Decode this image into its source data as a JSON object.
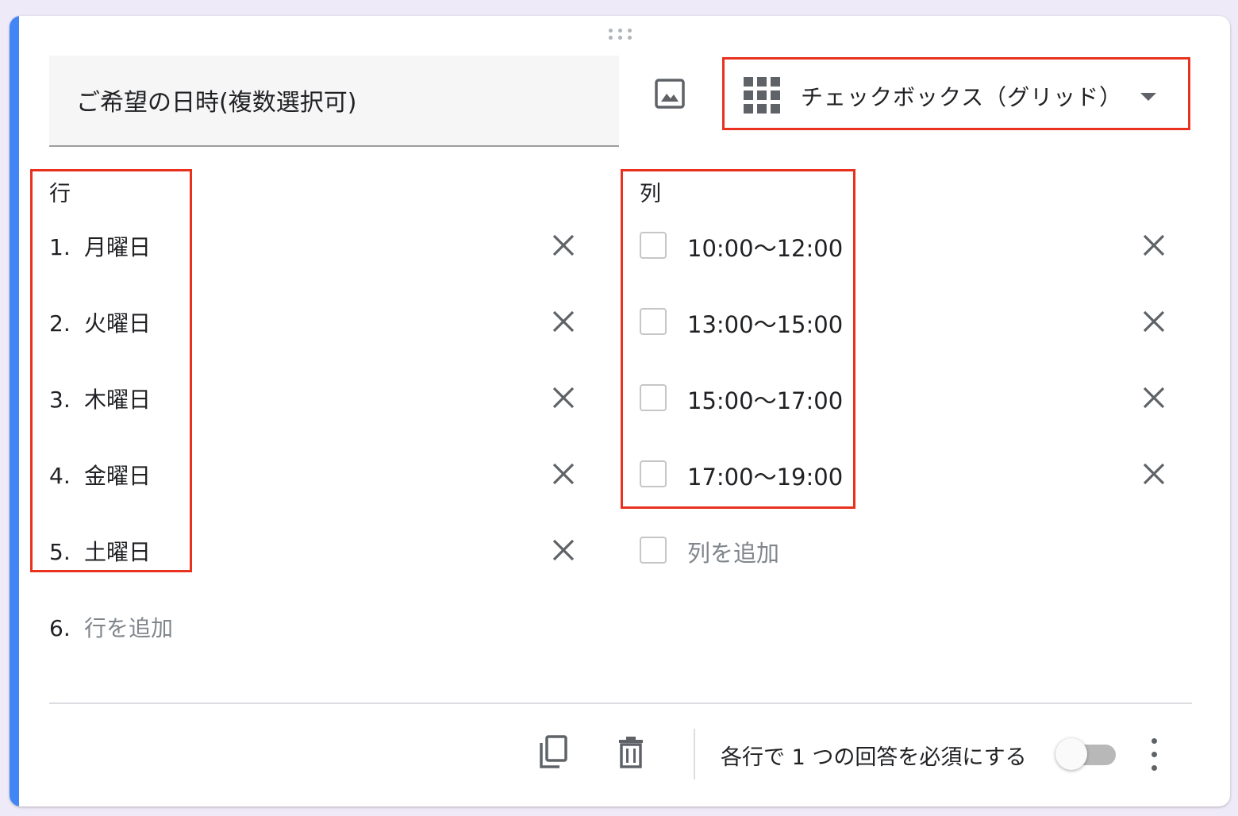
{
  "question": {
    "title": "ご希望の日時(複数選択可)"
  },
  "question_type": {
    "label": "チェックボックス（グリッド）",
    "icon": "grid-icon"
  },
  "rows_section": {
    "label": "行",
    "items": [
      {
        "number": "1.",
        "label": "月曜日"
      },
      {
        "number": "2.",
        "label": "火曜日"
      },
      {
        "number": "3.",
        "label": "木曜日"
      },
      {
        "number": "4.",
        "label": "金曜日"
      },
      {
        "number": "5.",
        "label": "土曜日"
      }
    ],
    "add": {
      "number": "6.",
      "label": "行を追加"
    }
  },
  "columns_section": {
    "label": "列",
    "items": [
      {
        "label": "10:00〜12:00"
      },
      {
        "label": "13:00〜15:00"
      },
      {
        "label": "15:00〜17:00"
      },
      {
        "label": "17:00〜19:00"
      }
    ],
    "add": {
      "label": "列を追加"
    }
  },
  "footer": {
    "required_label": "各行で 1 つの回答を必須にする",
    "required_toggle_on": false
  },
  "colors": {
    "accent": "#4285f4",
    "highlight": "#e8321f",
    "icon": "#5f6368"
  }
}
